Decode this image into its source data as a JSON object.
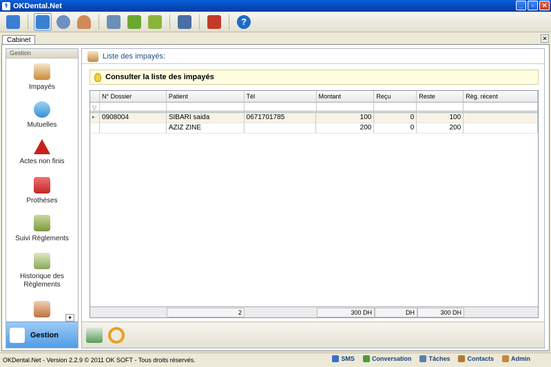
{
  "window": {
    "title": "OKDental.Net"
  },
  "toolbar": {
    "buttons": [
      {
        "name": "connect-icon",
        "color": "#3a7fd5"
      },
      {
        "name": "tooth-icon",
        "color": "#3b7fd1",
        "active": true
      },
      {
        "name": "calendar-clock-icon",
        "color": "#6d90c0"
      },
      {
        "name": "doctor-icon",
        "color": "#d08a5a"
      },
      {
        "name": "cart-icon",
        "color": "#6b8fb5"
      },
      {
        "name": "money-growth-icon",
        "color": "#6ba830"
      },
      {
        "name": "payment-icon",
        "color": "#8ab53c"
      },
      {
        "name": "monitor-icon",
        "color": "#4a6fa5"
      },
      {
        "name": "bar-chart-icon",
        "color": "#c23a2a"
      },
      {
        "name": "help-icon",
        "color": "#1f6ac6"
      }
    ]
  },
  "tab": {
    "label": "Cabinet"
  },
  "sidebar": {
    "header": "Gestion",
    "items": [
      {
        "label": "Impayés",
        "icon": "unpaid-icon"
      },
      {
        "label": "Mutuelles",
        "icon": "mutual-insurance-icon"
      },
      {
        "label": "Actes non finis",
        "icon": "warning-icon"
      },
      {
        "label": "Prothèses",
        "icon": "prosthesis-icon"
      },
      {
        "label": "Suivi Règlements",
        "icon": "payment-tracking-icon"
      },
      {
        "label": "Historique des Règlements",
        "icon": "payment-history-icon"
      }
    ],
    "footer": "Gestion"
  },
  "main": {
    "title": "Liste des impayés:",
    "banner": "Consulter la liste des impayés",
    "columns": [
      "N° Dossier",
      "Patient",
      "Tél",
      "Montant",
      "Reçu",
      "Reste",
      "Règ. récent"
    ],
    "rows": [
      {
        "dossier": "0908004",
        "patient": "SIBARI saida",
        "tel": "0671701785",
        "montant": "100",
        "recu": "0",
        "reste": "100",
        "reg": ""
      },
      {
        "dossier": "",
        "patient": "AZIZ ZINE",
        "tel": "",
        "montant": "200",
        "recu": "0",
        "reste": "200",
        "reg": ""
      }
    ],
    "footer": {
      "count": "2",
      "montant": "300 DH",
      "recu": "DH",
      "reste": "300 DH"
    }
  },
  "status": {
    "text": "OKDental.Net - Version 2.2.9 © 2011 OK SOFT - Tous droits réservés.",
    "items": [
      {
        "label": "SMS",
        "color": "#3a6fc5"
      },
      {
        "label": "Conversation",
        "color": "#4a9a3a"
      },
      {
        "label": "Tâches",
        "color": "#5a7fb0"
      },
      {
        "label": "Contacts",
        "color": "#b07a30"
      },
      {
        "label": "Admin",
        "color": "#c08a40"
      }
    ]
  }
}
